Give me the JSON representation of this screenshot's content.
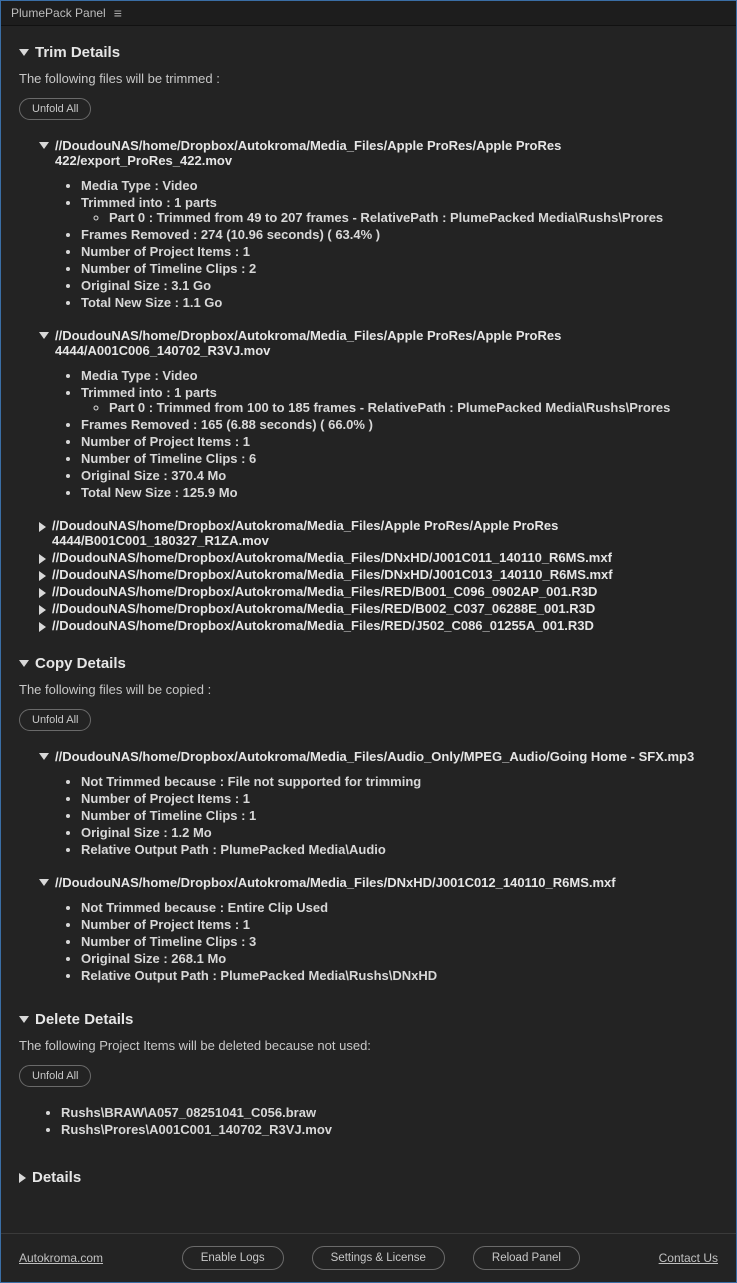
{
  "titlebar": {
    "title": "PlumePack Panel"
  },
  "trim": {
    "heading": "Trim Details",
    "subtext": "The following files will be trimmed :",
    "unfold_btn": "Unfold All",
    "files": [
      {
        "path": "//DoudouNAS/home/Dropbox/Autokroma/Media_Files/Apple ProRes/Apple ProRes 422/export_ProRes_422.mov",
        "expanded": true,
        "media_type": "Media Type : Video",
        "trimmed_into": "Trimmed into : 1 parts",
        "part": "Part 0 : Trimmed from 49 to 207 frames - RelativePath : PlumePacked Media\\Rushs\\Prores",
        "frames_removed": "Frames Removed : 274 (10.96 seconds) ( 63.4% )",
        "proj_items": "Number of Project Items : 1",
        "timeline_clips": "Number of Timeline Clips : 2",
        "orig_size": "Original Size : 3.1 Go",
        "new_size": "Total New Size : 1.1 Go"
      },
      {
        "path": "//DoudouNAS/home/Dropbox/Autokroma/Media_Files/Apple ProRes/Apple ProRes 4444/A001C006_140702_R3VJ.mov",
        "expanded": true,
        "media_type": "Media Type : Video",
        "trimmed_into": "Trimmed into : 1 parts",
        "part": "Part 0 : Trimmed from 100 to 185 frames - RelativePath : PlumePacked Media\\Rushs\\Prores",
        "frames_removed": "Frames Removed : 165 (6.88 seconds) ( 66.0% )",
        "proj_items": "Number of Project Items : 1",
        "timeline_clips": "Number of Timeline Clips : 6",
        "orig_size": "Original Size : 370.4 Mo",
        "new_size": "Total New Size : 125.9 Mo"
      }
    ],
    "collapsed": [
      "//DoudouNAS/home/Dropbox/Autokroma/Media_Files/Apple ProRes/Apple ProRes 4444/B001C001_180327_R1ZA.mov",
      "//DoudouNAS/home/Dropbox/Autokroma/Media_Files/DNxHD/J001C011_140110_R6MS.mxf",
      "//DoudouNAS/home/Dropbox/Autokroma/Media_Files/DNxHD/J001C013_140110_R6MS.mxf",
      "//DoudouNAS/home/Dropbox/Autokroma/Media_Files/RED/B001_C096_0902AP_001.R3D",
      "//DoudouNAS/home/Dropbox/Autokroma/Media_Files/RED/B002_C037_06288E_001.R3D",
      "//DoudouNAS/home/Dropbox/Autokroma/Media_Files/RED/J502_C086_01255A_001.R3D"
    ]
  },
  "copy": {
    "heading": "Copy Details",
    "subtext": "The following files will be copied :",
    "unfold_btn": "Unfold All",
    "files": [
      {
        "path": "//DoudouNAS/home/Dropbox/Autokroma/Media_Files/Audio_Only/MPEG_Audio/Going Home - SFX.mp3",
        "not_trimmed": "Not Trimmed because : File not supported for trimming",
        "proj_items": "Number of Project Items : 1",
        "timeline_clips": "Number of Timeline Clips : 1",
        "orig_size": "Original Size : 1.2 Mo",
        "rel_path": "Relative Output Path : PlumePacked Media\\Audio"
      },
      {
        "path": "//DoudouNAS/home/Dropbox/Autokroma/Media_Files/DNxHD/J001C012_140110_R6MS.mxf",
        "not_trimmed": "Not Trimmed because : Entire Clip Used",
        "proj_items": "Number of Project Items : 1",
        "timeline_clips": "Number of Timeline Clips : 3",
        "orig_size": "Original Size : 268.1 Mo",
        "rel_path": "Relative Output Path : PlumePacked Media\\Rushs\\DNxHD"
      }
    ]
  },
  "delete": {
    "heading": "Delete Details",
    "subtext": "The following Project Items will be deleted because not used:",
    "unfold_btn": "Unfold All",
    "items": [
      "Rushs\\BRAW\\A057_08251041_C056.braw",
      "Rushs\\Prores\\A001C001_140702_R3VJ.mov"
    ]
  },
  "details": {
    "heading": "Details"
  },
  "footer": {
    "site": "Autokroma.com",
    "enable_logs": "Enable Logs",
    "settings": "Settings & License",
    "reload": "Reload Panel",
    "contact": "Contact Us"
  }
}
